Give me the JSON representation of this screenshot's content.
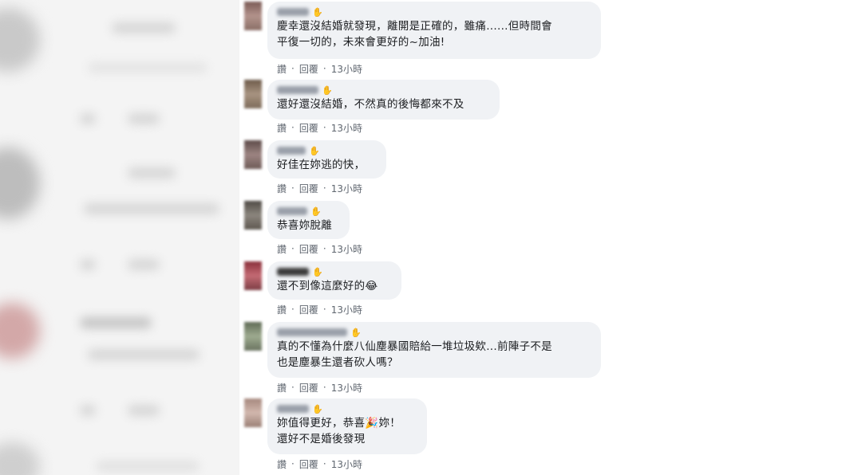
{
  "comments": [
    {
      "text": "慶幸還沒結婚就發現，離開是正確的，雖痛......但時間會\n平復一切的，未來會更好的~加油!",
      "actions": {
        "like": "讚",
        "reply": "回覆",
        "time": "13小時"
      }
    },
    {
      "text": "還好還沒結婚，不然真的後悔都來不及",
      "actions": {
        "like": "讚",
        "reply": "回覆",
        "time": "13小時"
      }
    },
    {
      "text": "好佳在妳逃的快，",
      "actions": {
        "like": "讚",
        "reply": "回覆",
        "time": "13小時"
      }
    },
    {
      "text": "恭喜妳脫離",
      "actions": {
        "like": "讚",
        "reply": "回覆",
        "time": "13小時"
      }
    },
    {
      "text": "還不到像這麼好的😂",
      "actions": {
        "like": "讚",
        "reply": "回覆",
        "time": "13小時"
      }
    },
    {
      "text": "真的不懂為什麼八仙塵暴國賠給一堆垃圾欸...前陣子不是\n也是塵暴生還者砍人嗎？",
      "actions": {
        "like": "讚",
        "reply": "回覆",
        "time": "13小時"
      }
    },
    {
      "text": "妳值得更好，恭喜🎉妳！\n還好不是婚後發現",
      "actions": {
        "like": "讚",
        "reply": "回覆",
        "time": "13小時"
      }
    }
  ],
  "icons": {
    "name_badge": "hand-icon",
    "separator": "dot-separator"
  },
  "colors": {
    "bubble": "#f0f2f5",
    "text": "#1c1e21",
    "meta": "#606770"
  }
}
